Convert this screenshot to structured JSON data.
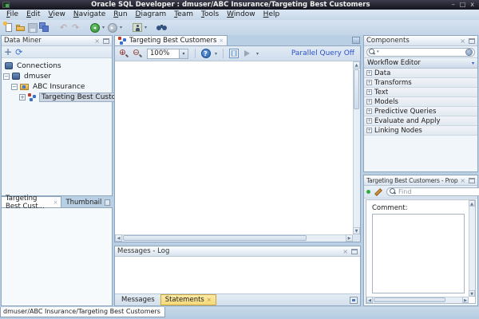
{
  "window": {
    "title": "Oracle SQL Developer : dmuser/ABC Insurance/Targeting Best Customers",
    "minimize_glyph": "–",
    "maximize_glyph": "□",
    "close_glyph": "x"
  },
  "menu": {
    "items": [
      "File",
      "Edit",
      "View",
      "Navigate",
      "Run",
      "Diagram",
      "Team",
      "Tools",
      "Window",
      "Help"
    ]
  },
  "data_miner": {
    "title": "Data Miner",
    "tree": [
      {
        "label": "Connections"
      },
      {
        "label": "dmuser"
      },
      {
        "label": "ABC Insurance"
      },
      {
        "label": "Targeting Best Customers"
      }
    ]
  },
  "left_dock": {
    "tabs": [
      {
        "label": "Targeting Best Cust..."
      },
      {
        "label": "Thumbnail"
      }
    ]
  },
  "editor": {
    "tab_label": "Targeting Best Customers",
    "zoom_value": "100%",
    "parallel_query_label": "Parallel Query Off"
  },
  "messages_log": {
    "title": "Messages - Log",
    "tabs": [
      {
        "label": "Messages"
      },
      {
        "label": "Statements"
      }
    ]
  },
  "components": {
    "title": "Components",
    "search_value": "",
    "selector_label": "Workflow Editor",
    "sections": [
      "Data",
      "Transforms",
      "Text",
      "Models",
      "Predictive Queries",
      "Evaluate and Apply",
      "Linking Nodes"
    ]
  },
  "properties": {
    "title": "Targeting Best Customers - Properties",
    "find_placeholder": "Find",
    "comment_label": "Comment:"
  },
  "status_bar": {
    "text": "dmuser/ABC Insurance/Targeting Best Customers"
  },
  "glyphs": {
    "undo": "↶",
    "redo": "↷",
    "caret": "▾",
    "back_arrow": "◂",
    "fwd_arrow": "▸",
    "up_arrow": "▲",
    "down_arrow": "▼",
    "left_arrow": "◀",
    "right_arrow": "▶",
    "close_small": "×",
    "plus": "+",
    "minus": "−",
    "refresh": "⟳",
    "help": "?"
  },
  "colors": {
    "accent_blue": "#2b50c8",
    "selection": "#ccd6e3",
    "statements_tab_yellow": "#f5d878",
    "frame_blue": "#b9cfe4",
    "title_bar_dark": "#14141e"
  }
}
